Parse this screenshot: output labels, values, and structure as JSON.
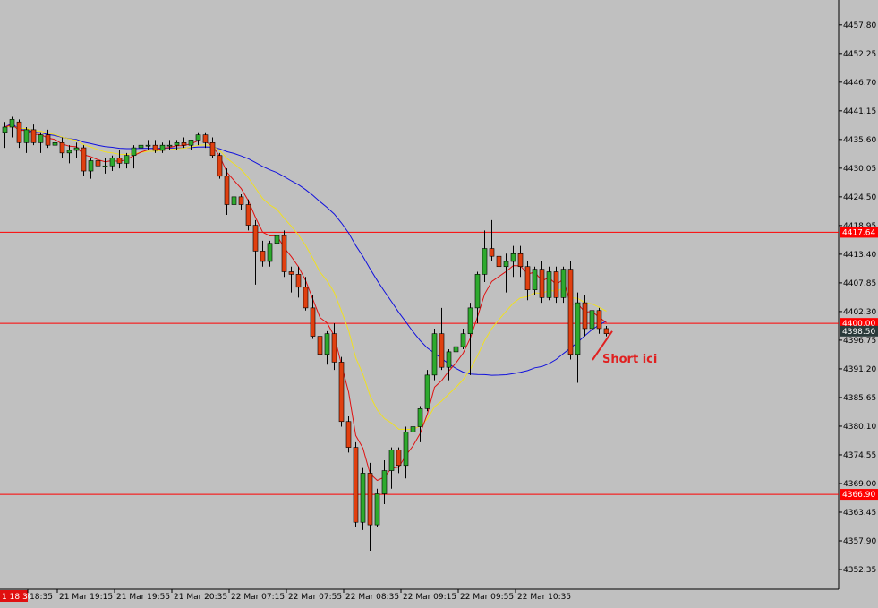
{
  "chart_data": {
    "type": "candlestick",
    "y_range": [
      4350.0,
      4460.0
    ],
    "price_ticks": [
      "4457.80",
      "4452.25",
      "4446.70",
      "4441.15",
      "4435.60",
      "4430.05",
      "4424.50",
      "4418.95",
      "4413.40",
      "4407.85",
      "4402.30",
      "4396.75",
      "4391.20",
      "4385.65",
      "4380.10",
      "4374.55",
      "4369.00",
      "4363.45",
      "4357.90",
      "4352.35"
    ],
    "time_labels": [
      "1 18:30",
      "18:35",
      "21 Mar 19:15",
      "21 Mar 19:55",
      "21 Mar 20:35",
      "22 Mar 07:15",
      "22 Mar 07:55",
      "22 Mar 08:35",
      "22 Mar 09:15",
      "22 Mar 09:55",
      "22 Mar 10:35"
    ],
    "horizontal_levels": [
      {
        "price": 4417.64,
        "label": "4417.64"
      },
      {
        "price": 4400.0,
        "label": "4400.00"
      },
      {
        "price": 4366.9,
        "label": "4366.90"
      }
    ],
    "current_price": {
      "price": 4398.5,
      "label": "4398.50"
    },
    "annotation": {
      "text": "Short ici",
      "price": 4398.5
    },
    "colors": {
      "bull": "#2eaa2e",
      "bear": "#e04010",
      "wick": "#000000",
      "ma_fast": "#e01010",
      "ma_mid": "#f0e020",
      "ma_slow": "#1010dd",
      "level": "#ff0000",
      "background": "#c0c0c0"
    },
    "candles": [
      [
        4437.0,
        4439.0,
        4434.0,
        4438.0
      ],
      [
        4438.0,
        4440.0,
        4436.0,
        4439.5
      ],
      [
        4439.0,
        4439.5,
        4434.0,
        4435.0
      ],
      [
        4435.0,
        4438.0,
        4433.0,
        4437.5
      ],
      [
        4437.5,
        4438.5,
        4434.5,
        4435.0
      ],
      [
        4435.0,
        4437.0,
        4433.0,
        4436.5
      ],
      [
        4436.5,
        4437.5,
        4434.0,
        4434.5
      ],
      [
        4434.5,
        4436.0,
        4433.0,
        4435.0
      ],
      [
        4435.0,
        4436.0,
        4432.0,
        4433.0
      ],
      [
        4433.0,
        4434.5,
        4431.0,
        4433.5
      ],
      [
        4433.5,
        4435.0,
        4432.0,
        4434.0
      ],
      [
        4434.0,
        4434.5,
        4428.5,
        4429.5
      ],
      [
        4429.5,
        4432.0,
        4428.0,
        4431.5
      ],
      [
        4431.5,
        4433.0,
        4429.5,
        4430.5
      ],
      [
        4430.5,
        4432.0,
        4429.0,
        4430.5
      ],
      [
        4430.5,
        4432.5,
        4429.5,
        4432.0
      ],
      [
        4432.0,
        4433.5,
        4430.0,
        4431.0
      ],
      [
        4431.0,
        4433.0,
        4430.0,
        4432.5
      ],
      [
        4432.5,
        4434.5,
        4430.0,
        4434.0
      ],
      [
        4434.0,
        4435.0,
        4433.0,
        4434.5
      ],
      [
        4434.5,
        4435.5,
        4433.5,
        4434.5
      ],
      [
        4434.5,
        4435.5,
        4433.0,
        4433.5
      ],
      [
        4433.5,
        4435.0,
        4433.0,
        4434.5
      ],
      [
        4434.5,
        4435.5,
        4433.5,
        4434.5
      ],
      [
        4434.5,
        4435.5,
        4433.5,
        4435.0
      ],
      [
        4435.0,
        4436.0,
        4434.0,
        4434.5
      ],
      [
        4434.5,
        4435.5,
        4433.5,
        4435.5
      ],
      [
        4435.5,
        4437.0,
        4434.5,
        4436.5
      ],
      [
        4436.5,
        4437.0,
        4434.0,
        4435.0
      ],
      [
        4435.0,
        4436.0,
        4432.0,
        4432.5
      ],
      [
        4432.5,
        4433.0,
        4428.0,
        4428.5
      ],
      [
        4428.5,
        4430.0,
        4421.0,
        4423.0
      ],
      [
        4423.0,
        4425.0,
        4421.0,
        4424.5
      ],
      [
        4424.5,
        4425.0,
        4422.0,
        4423.0
      ],
      [
        4423.0,
        4424.0,
        4418.0,
        4419.0
      ],
      [
        4419.0,
        4420.0,
        4407.5,
        4414.0
      ],
      [
        4414.0,
        4416.0,
        4411.0,
        4412.0
      ],
      [
        4412.0,
        4416.0,
        4411.0,
        4415.5
      ],
      [
        4415.5,
        4421.0,
        4414.0,
        4417.0
      ],
      [
        4417.0,
        4418.0,
        4409.0,
        4410.0
      ],
      [
        4410.0,
        4411.0,
        4406.0,
        4409.5
      ],
      [
        4409.5,
        4411.0,
        4405.0,
        4407.0
      ],
      [
        4407.0,
        4409.0,
        4402.5,
        4403.0
      ],
      [
        4403.0,
        4405.5,
        4397.0,
        4397.5
      ],
      [
        4397.5,
        4398.0,
        4390.0,
        4394.0
      ],
      [
        4394.0,
        4398.5,
        4392.0,
        4398.0
      ],
      [
        4398.0,
        4400.0,
        4391.0,
        4392.5
      ],
      [
        4392.5,
        4393.5,
        4380.0,
        4381.0
      ],
      [
        4381.0,
        4382.0,
        4375.0,
        4376.0
      ],
      [
        4376.0,
        4377.0,
        4360.5,
        4361.5
      ],
      [
        4361.5,
        4372.0,
        4360.0,
        4371.0
      ],
      [
        4371.0,
        4373.0,
        4356.0,
        4361.0
      ],
      [
        4361.0,
        4368.0,
        4360.5,
        4367.0
      ],
      [
        4367.0,
        4373.5,
        4365.0,
        4371.5
      ],
      [
        4371.5,
        4376.0,
        4368.0,
        4375.5
      ],
      [
        4375.5,
        4376.0,
        4371.0,
        4372.5
      ],
      [
        4372.5,
        4380.0,
        4370.0,
        4379.0
      ],
      [
        4379.0,
        4381.0,
        4378.0,
        4380.0
      ],
      [
        4380.0,
        4384.0,
        4377.0,
        4383.5
      ],
      [
        4383.5,
        4391.0,
        4383.0,
        4390.0
      ],
      [
        4390.0,
        4399.0,
        4389.0,
        4398.0
      ],
      [
        4398.0,
        4403.0,
        4391.0,
        4391.5
      ],
      [
        4391.5,
        4395.0,
        4389.0,
        4394.5
      ],
      [
        4394.5,
        4396.0,
        4392.0,
        4395.5
      ],
      [
        4395.5,
        4399.0,
        4395.0,
        4398.0
      ],
      [
        4398.0,
        4404.0,
        4390.0,
        4403.0
      ],
      [
        4403.0,
        4410.0,
        4400.0,
        4409.5
      ],
      [
        4409.5,
        4418.0,
        4408.0,
        4414.5
      ],
      [
        4414.5,
        4420.0,
        4412.0,
        4413.0
      ],
      [
        4413.0,
        4417.0,
        4409.0,
        4411.0
      ],
      [
        4411.0,
        4413.5,
        4406.0,
        4412.0
      ],
      [
        4412.0,
        4415.0,
        4409.0,
        4413.5
      ],
      [
        4413.5,
        4415.0,
        4409.0,
        4411.0
      ],
      [
        4411.0,
        4412.0,
        4404.5,
        4406.5
      ],
      [
        4406.5,
        4411.0,
        4405.5,
        4410.5
      ],
      [
        4410.5,
        4412.0,
        4404.0,
        4405.0
      ],
      [
        4405.0,
        4411.0,
        4404.5,
        4410.0
      ],
      [
        4410.0,
        4411.0,
        4404.0,
        4405.0
      ],
      [
        4405.0,
        4411.0,
        4404.0,
        4410.5
      ],
      [
        4410.5,
        4412.0,
        4393.0,
        4394.0
      ],
      [
        4394.0,
        4406.0,
        4388.5,
        4404.0
      ],
      [
        4404.0,
        4405.5,
        4397.5,
        4399.0
      ],
      [
        4399.0,
        4404.5,
        4398.5,
        4402.5
      ],
      [
        4402.5,
        4403.0,
        4398.0,
        4399.0
      ],
      [
        4399.0,
        4399.5,
        4397.5,
        4398.0
      ]
    ]
  }
}
